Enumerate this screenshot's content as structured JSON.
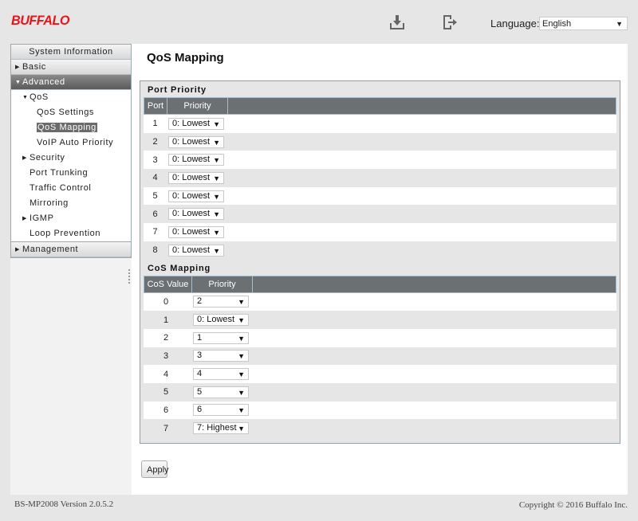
{
  "header": {
    "logo": "BUFFALO",
    "download_icon": "download-icon",
    "logout_icon": "logout-icon",
    "language_label": "Language:",
    "language_value": "English",
    "dropdown_arrow": "▼"
  },
  "sidebar": {
    "system_information": "System Information",
    "basic": "Basic",
    "advanced": "Advanced",
    "qos": "QoS",
    "qos_settings": "QoS Settings",
    "qos_mapping": "QoS Mapping",
    "voip_auto_priority": "VoIP Auto Priority",
    "security": "Security",
    "port_trunking": "Port Trunking",
    "traffic_control": "Traffic Control",
    "mirroring": "Mirroring",
    "igmp": "IGMP",
    "loop_prevention": "Loop Prevention",
    "management": "Management",
    "tri_right": "▶",
    "tri_down": "▼"
  },
  "main": {
    "title": "QoS Mapping",
    "port_priority": {
      "title": "Port Priority",
      "headers": [
        "Port",
        "Priority"
      ],
      "rows": [
        {
          "port": "1",
          "priority": "0: Lowest"
        },
        {
          "port": "2",
          "priority": "0: Lowest"
        },
        {
          "port": "3",
          "priority": "0: Lowest"
        },
        {
          "port": "4",
          "priority": "0: Lowest"
        },
        {
          "port": "5",
          "priority": "0: Lowest"
        },
        {
          "port": "6",
          "priority": "0: Lowest"
        },
        {
          "port": "7",
          "priority": "0: Lowest"
        },
        {
          "port": "8",
          "priority": "0: Lowest"
        }
      ]
    },
    "cos_mapping": {
      "title": "CoS Mapping",
      "headers": [
        "CoS Value",
        "Priority"
      ],
      "rows": [
        {
          "cos": "0",
          "priority": "2"
        },
        {
          "cos": "1",
          "priority": "0: Lowest"
        },
        {
          "cos": "2",
          "priority": "1"
        },
        {
          "cos": "3",
          "priority": "3"
        },
        {
          "cos": "4",
          "priority": "4"
        },
        {
          "cos": "5",
          "priority": "5"
        },
        {
          "cos": "6",
          "priority": "6"
        },
        {
          "cos": "7",
          "priority": "7: Highest"
        }
      ]
    },
    "apply_label": "Apply"
  },
  "footer": {
    "version": "BS-MP2008 Version 2.0.5.2",
    "copyright": "Copyright © 2016 Buffalo Inc."
  }
}
